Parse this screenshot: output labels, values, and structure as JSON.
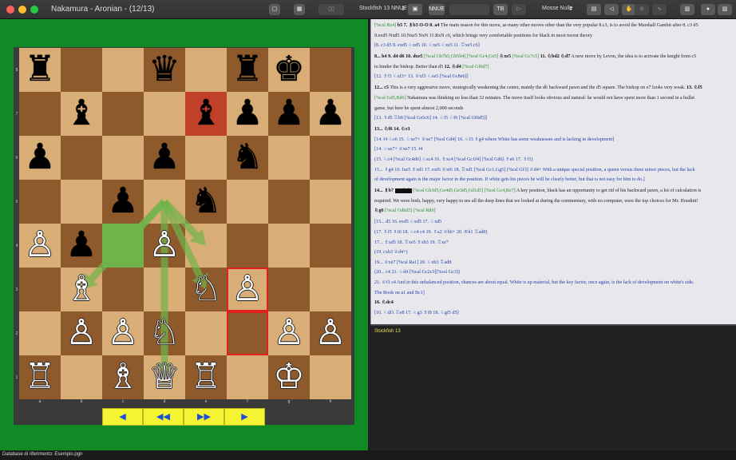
{
  "window": {
    "title": "Nakamura - Aronian - (12/13)"
  },
  "toolbar": {
    "engine_label": "Stockfish 13 NNUE",
    "engine_arrows": "⇕",
    "nnue_label": "NNUE",
    "tb_label": "TB",
    "moves_label": "Mosse Nulle",
    "moves_arrows": "⇕"
  },
  "colors": {
    "light_square": "#d9ae76",
    "dark_square": "#8e5a2c",
    "highlight": "#c0402a",
    "arrow": "#6fb34a",
    "border": "#e02020"
  },
  "board": {
    "pieces": [
      {
        "sq": "a8",
        "glyph": "♜",
        "color": "#000"
      },
      {
        "sq": "d8",
        "glyph": "♛",
        "color": "#000"
      },
      {
        "sq": "f8",
        "glyph": "♜",
        "color": "#000"
      },
      {
        "sq": "g8",
        "glyph": "♚",
        "color": "#000"
      },
      {
        "sq": "b7",
        "glyph": "♝",
        "color": "#000"
      },
      {
        "sq": "e7",
        "glyph": "♝",
        "color": "#000"
      },
      {
        "sq": "f7",
        "glyph": "♟",
        "color": "#000"
      },
      {
        "sq": "g7",
        "glyph": "♟",
        "color": "#000"
      },
      {
        "sq": "h7",
        "glyph": "♟",
        "color": "#000"
      },
      {
        "sq": "a6",
        "glyph": "♟",
        "color": "#000"
      },
      {
        "sq": "d6",
        "glyph": "♟",
        "color": "#000"
      },
      {
        "sq": "f6",
        "glyph": "♞",
        "color": "#000"
      },
      {
        "sq": "c5",
        "glyph": "♟",
        "color": "#000"
      },
      {
        "sq": "e5",
        "glyph": "♞",
        "color": "#000"
      },
      {
        "sq": "a4",
        "glyph": "♙",
        "color": "#fff"
      },
      {
        "sq": "b4",
        "glyph": "♟",
        "color": "#000"
      },
      {
        "sq": "d4",
        "glyph": "♙",
        "color": "#fff"
      },
      {
        "sq": "b3",
        "glyph": "♗",
        "color": "#fff"
      },
      {
        "sq": "e3",
        "glyph": "♘",
        "color": "#fff"
      },
      {
        "sq": "f3",
        "glyph": "♙",
        "color": "#fff"
      },
      {
        "sq": "b2",
        "glyph": "♙",
        "color": "#fff"
      },
      {
        "sq": "c2",
        "glyph": "♙",
        "color": "#fff"
      },
      {
        "sq": "d2",
        "glyph": "♘",
        "color": "#fff"
      },
      {
        "sq": "g2",
        "glyph": "♙",
        "color": "#fff"
      },
      {
        "sq": "h2",
        "glyph": "♙",
        "color": "#fff"
      },
      {
        "sq": "a1",
        "glyph": "♖",
        "color": "#fff"
      },
      {
        "sq": "c1",
        "glyph": "♗",
        "color": "#fff"
      },
      {
        "sq": "d1",
        "glyph": "♕",
        "color": "#fff"
      },
      {
        "sq": "e1",
        "glyph": "♖",
        "color": "#fff"
      },
      {
        "sq": "g1",
        "glyph": "♔",
        "color": "#fff"
      }
    ],
    "highlight_squares": [
      "e7"
    ],
    "green_squares": [
      "c4"
    ],
    "bordered_squares": [
      "f3",
      "f2"
    ],
    "arrows": [
      [
        "d5",
        "b3"
      ],
      [
        "d5",
        "c4"
      ],
      [
        "d5",
        "d1"
      ],
      [
        "d5",
        "e3"
      ],
      [
        "d5",
        "e4"
      ]
    ],
    "ranks": [
      "8",
      "7",
      "6",
      "5",
      "4",
      "3",
      "2",
      "1"
    ],
    "files": [
      "a",
      "b",
      "c",
      "d",
      "e",
      "f",
      "g",
      "h"
    ]
  },
  "nav": {
    "prev": "◀",
    "first": "◀◀",
    "last": "▶▶",
    "next": "▶"
  },
  "notation": [
    [
      {
        "t": "[%csl Re4]",
        "c": "g"
      },
      {
        "t": " "
      },
      {
        "t": "b5 7. ♗b3 O-O 8. a4",
        "b": true
      },
      {
        "t": " The main reason for this move, as many other moves other than the very popular 8.c3, is to avoid the Marshall Gambit after 8. c3 d5"
      }
    ],
    [
      {
        "t": "9.exd5 Nxd5 10.Nxe5 NxN 11.RxN c6, which brings very comfortable positions for black in most recent theory"
      }
    ],
    [
      {
        "t": "      "
      },
      {
        "t": "[8. c3 d5 9. exd5 ♘xd5 10. ♘xe5 ♘xe5 11. ♖xe5 c6]",
        "c": "bl"
      }
    ],
    [
      {
        "t": "      "
      },
      {
        "t": "8... b4 9. d4 d6 10. dxe5",
        "b": true
      },
      {
        "t": " "
      },
      {
        "t": "[%cal Gb7b5,Gb5b4] [%csl Gc4,Ge5]",
        "c": "g"
      },
      {
        "t": " "
      },
      {
        "t": "♘xe5",
        "b": true
      },
      {
        "t": " "
      },
      {
        "t": "[%cal Gc7c5]",
        "c": "g"
      },
      {
        "t": " "
      },
      {
        "t": "11. ♘bd2 ♘d7",
        "b": true
      },
      {
        "t": " A new move by Levon, the idea is to activate the knight from c5"
      }
    ],
    [
      {
        "t": "to hinder the bishop. Better than d5 "
      },
      {
        "t": "12. ♘d4",
        "b": true
      },
      {
        "t": " "
      },
      {
        "t": "[%cal Gf6d7]",
        "c": "g"
      }
    ],
    [
      {
        "t": "      "
      },
      {
        "t": "[12. ♗f1 ♘xf3+ 13. ♕xf3 ♘xe5 [%cal Gc8e6]]",
        "c": "bl"
      }
    ],
    [
      {
        "t": "12... c5",
        "b": true
      },
      {
        "t": " This is a very aggressive move, strategically weakening the center, mainly the d6 backward pawn and the d5 square. The bishop on e7 looks very weak. "
      },
      {
        "t": "13. ♘f5",
        "b": true
      }
    ],
    [
      {
        "t": "[%csl Gd5,Rd6]",
        "c": "g"
      },
      {
        "t": " Nakamura was thinking no less than 32 minutes. The move itself looks obvious and natural: he would not have spent more than 1 second in a bullet"
      }
    ],
    [
      {
        "t": "game, but here he spent almost 2,000 seconds"
      }
    ],
    [
      {
        "t": "      "
      },
      {
        "t": "[13. ♗d5 ♖b8 [%cal Ge5c6] 14. ♘f5 ♘f6 [%cal Gf6d5]]",
        "c": "bl"
      }
    ],
    [
      {
        "t": "13... ♘f6 14. ♘e3",
        "b": true
      }
    ],
    [
      {
        "t": "      "
      },
      {
        "t": "[14. f4 ♘c6 15. ♘xe7+ ♕xe7 [%csl Gd4] 16. ♘f3 ♗g4 where White has some weaknesses and is lacking in development]",
        "c": "bl"
      }
    ],
    [
      {
        "t": "      "
      },
      {
        "t": "[14. ♘xe7+ ♕xe7 15. f4",
        "c": "bl"
      }
    ],
    [
      {
        "t": "            "
      },
      {
        "t": "(15. ♘c4 [%cal Gc4d6] ♘xc4 16. ♗xc4 [%cal Gc1f4] [%csl Gd6] ♗e6 17. ♗f1)",
        "c": "bl"
      }
    ],
    [
      {
        "t": "      "
      },
      {
        "t": "15... ♗g4 16. fxe5 ♗xd1 17. exf6 ♕xf6 18. ♖xd1 [%csl Gc1,Gg5] [%csl Gf3] ♕d4+ With a unique special position, a queen versus three minor pieces, but the lack",
        "c": "bl"
      }
    ],
    [
      {
        "t": "of development again is the major factor in the position. If white gets his pieces he will be clearly better, but that is not easy for him to do.]",
        "c": "bl"
      }
    ],
    [
      {
        "t": "14... ♗b7 ",
        "b": true
      },
      {
        "t": "15. ♗d5",
        "b": true,
        "hl": true
      },
      {
        "t": " "
      },
      {
        "t": "[%cal Gb3d5,Ge4d5,Ge3d5,Gd1d5] [%csl Gc4,Re7]",
        "c": "g"
      },
      {
        "t": " A key position, black has an opportunity to get rid of his backward pawn, a lot of calculation is"
      }
    ],
    [
      {
        "t": "required. We were both, happy, very happy to see all the deep lines that we looked at during the commentary, with no computer, were the top choices for Mr. Houdini!"
      }
    ],
    [
      {
        "t": "♘g6",
        "b": true
      },
      {
        "t": " "
      },
      {
        "t": "[%cal Gd6d5] [%csl Rd6]",
        "c": "g"
      }
    ],
    [
      {
        "t": "      "
      },
      {
        "t": "[15... d5 16. exd5 ♘xd5 17. ♘xd5",
        "c": "bl"
      }
    ],
    [
      {
        "t": "            "
      },
      {
        "t": "(17. ♗f5 ♗f6 18. ♘c4 c4 19. ♗a2 ♕b6+ 20. ♔h1 ♖ad8)",
        "c": "bl"
      }
    ],
    [
      {
        "t": "      "
      },
      {
        "t": "17... ♗xd5 18. ♖xe5 ♗xb3 19. ♖xe7",
        "c": "bl"
      }
    ],
    [
      {
        "t": "            "
      },
      {
        "t": "(19. cxb3 ♕d4+)",
        "c": "bl"
      }
    ],
    [
      {
        "t": "      "
      },
      {
        "t": "19... ♕xe7 [%csl Ra1] 20. ♘xb3 ♖ad8",
        "c": "bl"
      }
    ],
    [
      {
        "t": "            "
      },
      {
        "t": "(20... c4 21. ♘d4 [%cal Gc2c3][%csl Gc3])",
        "c": "bl"
      }
    ],
    [
      {
        "t": "      "
      },
      {
        "t": "21. ♕f1 c4 And in this unbalanced position, chances are about equal. White is up material, but the key factor, once again, is the lack of development on white's side.",
        "c": "bl"
      }
    ],
    [
      {
        "t": "      "
      },
      {
        "t": "The Rook on a1 and Bc1]",
        "c": "bl"
      }
    ],
    [
      {
        "t": "16. ♘dc4",
        "b": true
      }
    ],
    [
      {
        "t": "      "
      },
      {
        "t": "[16. ♘df1 ♖e8 17. ♘g3 ♗f8 18. ♘gf5 d5]",
        "c": "bl"
      }
    ]
  ],
  "engine": {
    "name": "Stockfish 13"
  },
  "status": {
    "text": "Database di riferimento: Esempio.pgn"
  }
}
